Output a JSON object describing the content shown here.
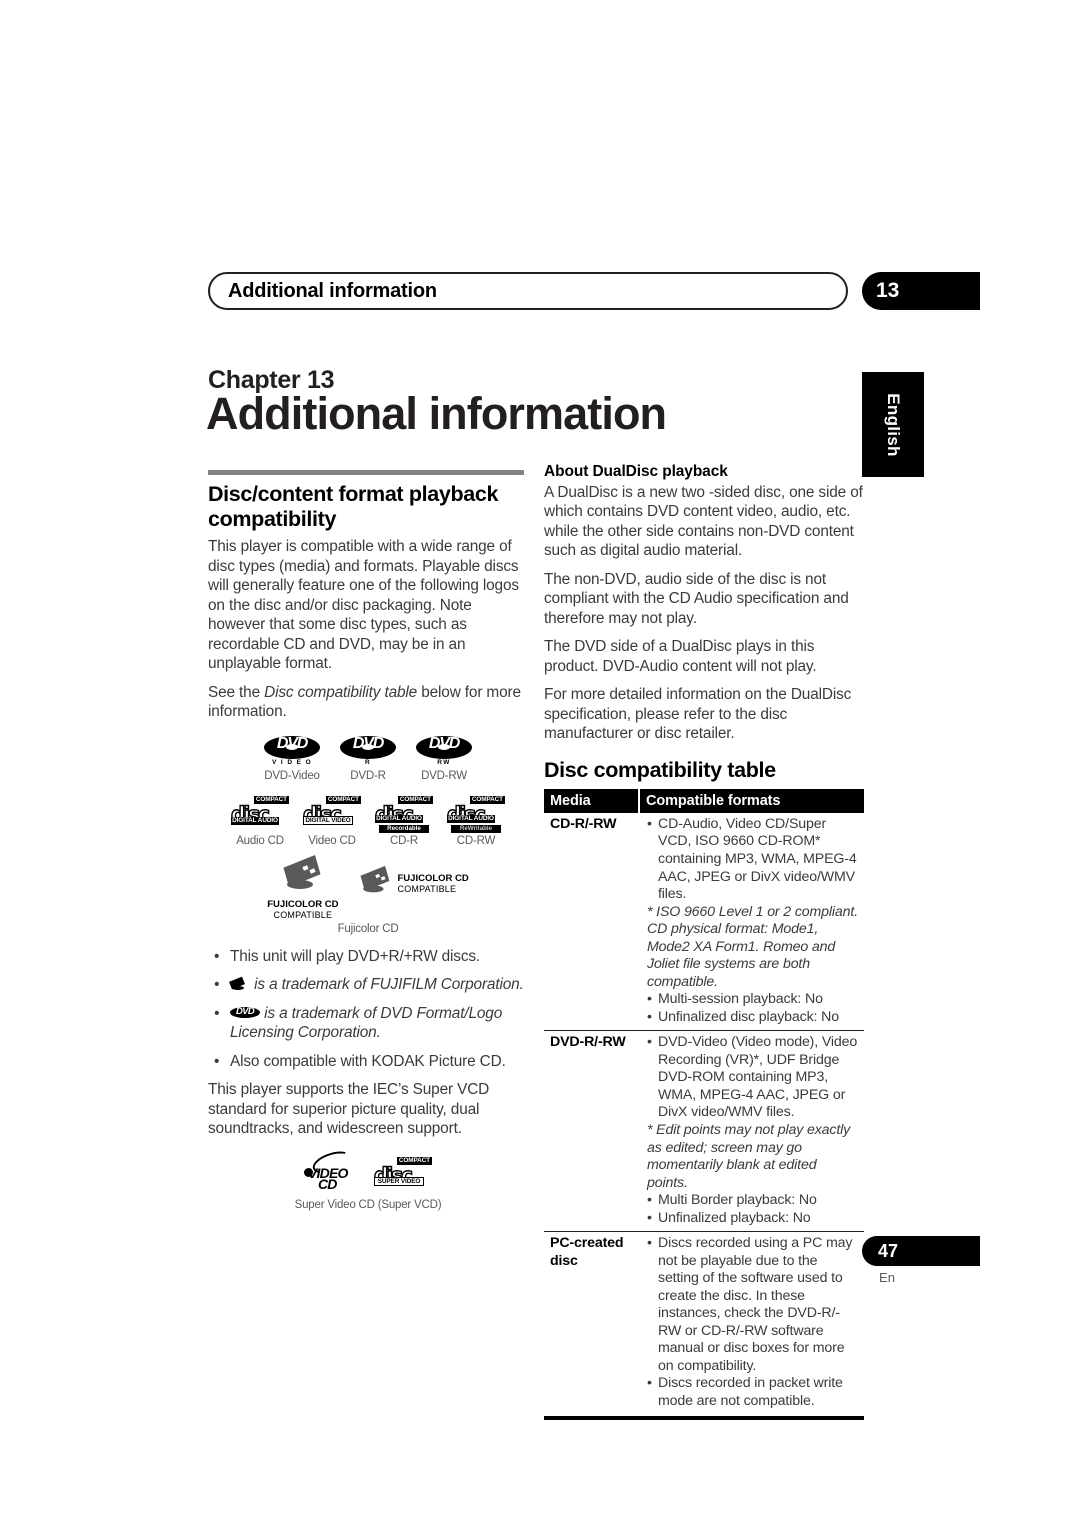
{
  "running_header": {
    "title": "Additional information",
    "chapter_badge": "13"
  },
  "side_tab": {
    "language": "English"
  },
  "chapter": {
    "label": "Chapter 13",
    "title": "Additional information"
  },
  "left_column": {
    "section_heading": "Disc/content format playback compatibility",
    "paragraph_1": "This player is compatible with a wide range of disc types (media) and formats. Playable discs will generally feature one of the following logos on the disc and/or disc packaging. Note however that some disc types, such as recordable CD and DVD, may be in an unplayable format.",
    "paragraph_2_pre": "See the ",
    "paragraph_2_italic": "Disc compatibility table",
    "paragraph_2_post": " below for more information.",
    "logos": {
      "row1": [
        {
          "mark": "DVD",
          "sub": "V I D E O",
          "caption": "DVD-Video"
        },
        {
          "mark": "DVD",
          "sub": "R",
          "caption": "DVD-R"
        },
        {
          "mark": "DVD",
          "sub": "RW",
          "caption": "DVD-RW"
        }
      ],
      "row2": [
        {
          "compact": "COMPACT",
          "disc": "disc",
          "band": "DIGITAL AUDIO",
          "band2": "",
          "caption": "Audio CD"
        },
        {
          "compact": "COMPACT",
          "disc": "disc",
          "band": "",
          "band2": "DIGITAL VIDEO",
          "caption": "Video CD"
        },
        {
          "compact": "COMPACT",
          "disc": "disc",
          "band": "DIGITAL AUDIO",
          "band2": "Recordable",
          "caption": "CD-R"
        },
        {
          "compact": "COMPACT",
          "disc": "disc",
          "band": "DIGITAL AUDIO",
          "band2": "ReWritable",
          "caption": "CD-RW"
        }
      ],
      "row3": {
        "fuji_line1": "FUJICOLOR CD",
        "fuji_line2": "COMPATIBLE",
        "caption": "Fujicolor CD"
      },
      "svcd": {
        "video": "VIDEO",
        "cd": "CD",
        "compact": "COMPACT",
        "disc": "disc",
        "band": "SUPER VIDEO",
        "caption": "Super Video CD (Super VCD)"
      }
    },
    "bullets": [
      {
        "text": "This unit will play DVD+R/+RW discs.",
        "icon": "",
        "italic": false
      },
      {
        "text": " is a trademark of FUJIFILM Corporation.",
        "icon": "fujifilm-mark",
        "italic": true
      },
      {
        "text": " is a trademark of DVD Format/Logo Licensing Corporation.",
        "icon": "dvd-mark",
        "italic": true
      },
      {
        "text": "Also compatible with KODAK Picture CD.",
        "icon": "",
        "italic": false
      }
    ],
    "paragraph_3": "This player supports the IEC’s Super VCD standard for superior picture quality, dual soundtracks, and widescreen support."
  },
  "right_column": {
    "dualdisc_heading": "About DualDisc playback",
    "dualdisc_paragraphs": [
      "A DualDisc is a new two -sided disc, one side of which contains DVD content video, audio, etc. while the other side contains non-DVD content such as digital audio material.",
      "The non-DVD, audio side of the disc is not compliant with the CD Audio specification and therefore may not play.",
      "The DVD side of a DualDisc plays in this product. DVD-Audio content will not play.",
      "For more detailed information on the DualDisc specification, please refer to the disc manufacturer or disc retailer."
    ],
    "table_heading": "Disc compatibility table",
    "table": {
      "headers": [
        "Media",
        "Compatible formats"
      ],
      "rows": [
        {
          "media": "CD-R/-RW",
          "blocks": [
            {
              "style": "bullet",
              "text": "CD-Audio, Video CD/Super VCD, ISO 9660 CD-ROM* containing MP3, WMA, MPEG-4 AAC, JPEG or DivX video/WMV files."
            },
            {
              "style": "note",
              "text": "* ISO 9660 Level 1 or 2 compliant. CD physical format: Mode1, Mode2 XA Form1. Romeo and Joliet file systems are both compatible."
            },
            {
              "style": "bullet",
              "text": "Multi-session playback: No"
            },
            {
              "style": "bullet",
              "text": "Unfinalized disc playback: No"
            }
          ]
        },
        {
          "media": "DVD-R/-RW",
          "blocks": [
            {
              "style": "bullet",
              "text": "DVD-Video (Video mode), Video Recording (VR)*, UDF Bridge DVD-ROM containing MP3, WMA, MPEG-4 AAC, JPEG or DivX video/WMV files."
            },
            {
              "style": "note",
              "text": "* Edit points may not play exactly as edited; screen may go momentarily blank at edited points."
            },
            {
              "style": "bullet",
              "text": "Multi Border playback: No"
            },
            {
              "style": "bullet",
              "text": "Unfinalized playback: No"
            }
          ]
        },
        {
          "media": "PC-created disc",
          "blocks": [
            {
              "style": "bullet",
              "text": "Discs recorded using a PC may not be playable due to the setting of the software used to create the disc. In these instances, check the DVD-R/-RW or CD-R/-RW software manual or disc boxes for more on compatibility."
            },
            {
              "style": "bullet",
              "text": "Discs recorded in packet write mode are not compatible."
            }
          ]
        }
      ]
    }
  },
  "footer": {
    "page_number": "47",
    "language_code": "En"
  },
  "colors": {
    "ink": "#231f20",
    "body_text": "#3b3b3b",
    "caption": "#58595b",
    "rule_gray": "#808285",
    "black": "#000000"
  }
}
